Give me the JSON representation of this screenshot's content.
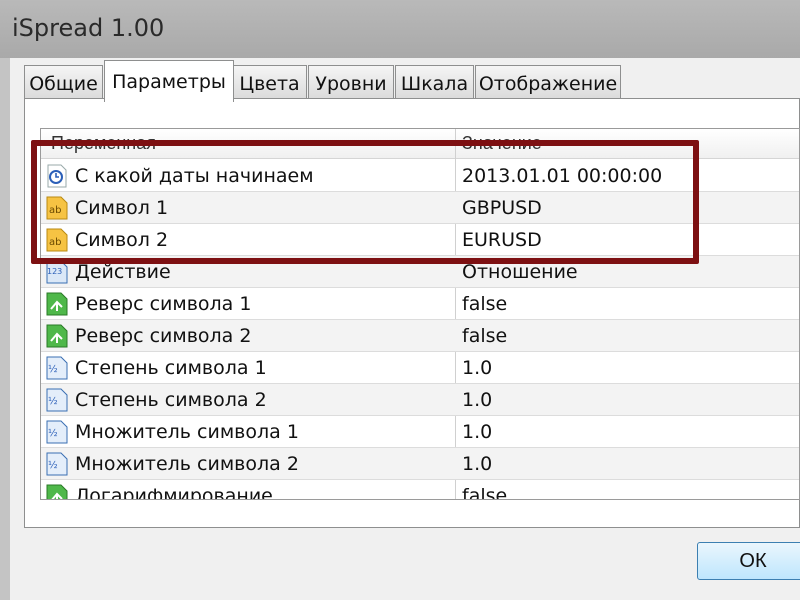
{
  "window": {
    "title": "iSpread 1.00"
  },
  "tabs": [
    {
      "label": "Общие"
    },
    {
      "label": "Параметры",
      "active": true
    },
    {
      "label": "Цвета"
    },
    {
      "label": "Уровни"
    },
    {
      "label": "Шкала"
    },
    {
      "label": "Отображение"
    }
  ],
  "grid": {
    "columns": {
      "variable": "Переменная",
      "value": "Значение"
    },
    "rows": [
      {
        "icon": "clock-icon",
        "name": "С какой даты начинаем",
        "value": "2013.01.01 00:00:00"
      },
      {
        "icon": "string-ab-icon",
        "name": "Символ 1",
        "value": "GBPUSD"
      },
      {
        "icon": "string-ab-icon",
        "name": "Символ 2",
        "value": "EURUSD"
      },
      {
        "icon": "enum-123-icon",
        "name": "Действие",
        "value": "Отношение"
      },
      {
        "icon": "bool-arrow-icon",
        "name": "Реверс символа 1",
        "value": "false"
      },
      {
        "icon": "bool-arrow-icon",
        "name": "Реверс символа 2",
        "value": "false"
      },
      {
        "icon": "fraction-half-icon",
        "name": "Степень символа 1",
        "value": "1.0"
      },
      {
        "icon": "fraction-half-icon",
        "name": "Степень символа 2",
        "value": "1.0"
      },
      {
        "icon": "fraction-half-icon",
        "name": "Множитель символа 1",
        "value": "1.0"
      },
      {
        "icon": "fraction-half-icon",
        "name": "Множитель символа 2",
        "value": "1.0"
      },
      {
        "icon": "bool-arrow-icon",
        "name": "Логарифмирование",
        "value": "false"
      }
    ]
  },
  "buttons": {
    "ok": "ОК"
  },
  "colors": {
    "highlight_frame": "#7d1012",
    "ok_button": "#bee6fd"
  }
}
